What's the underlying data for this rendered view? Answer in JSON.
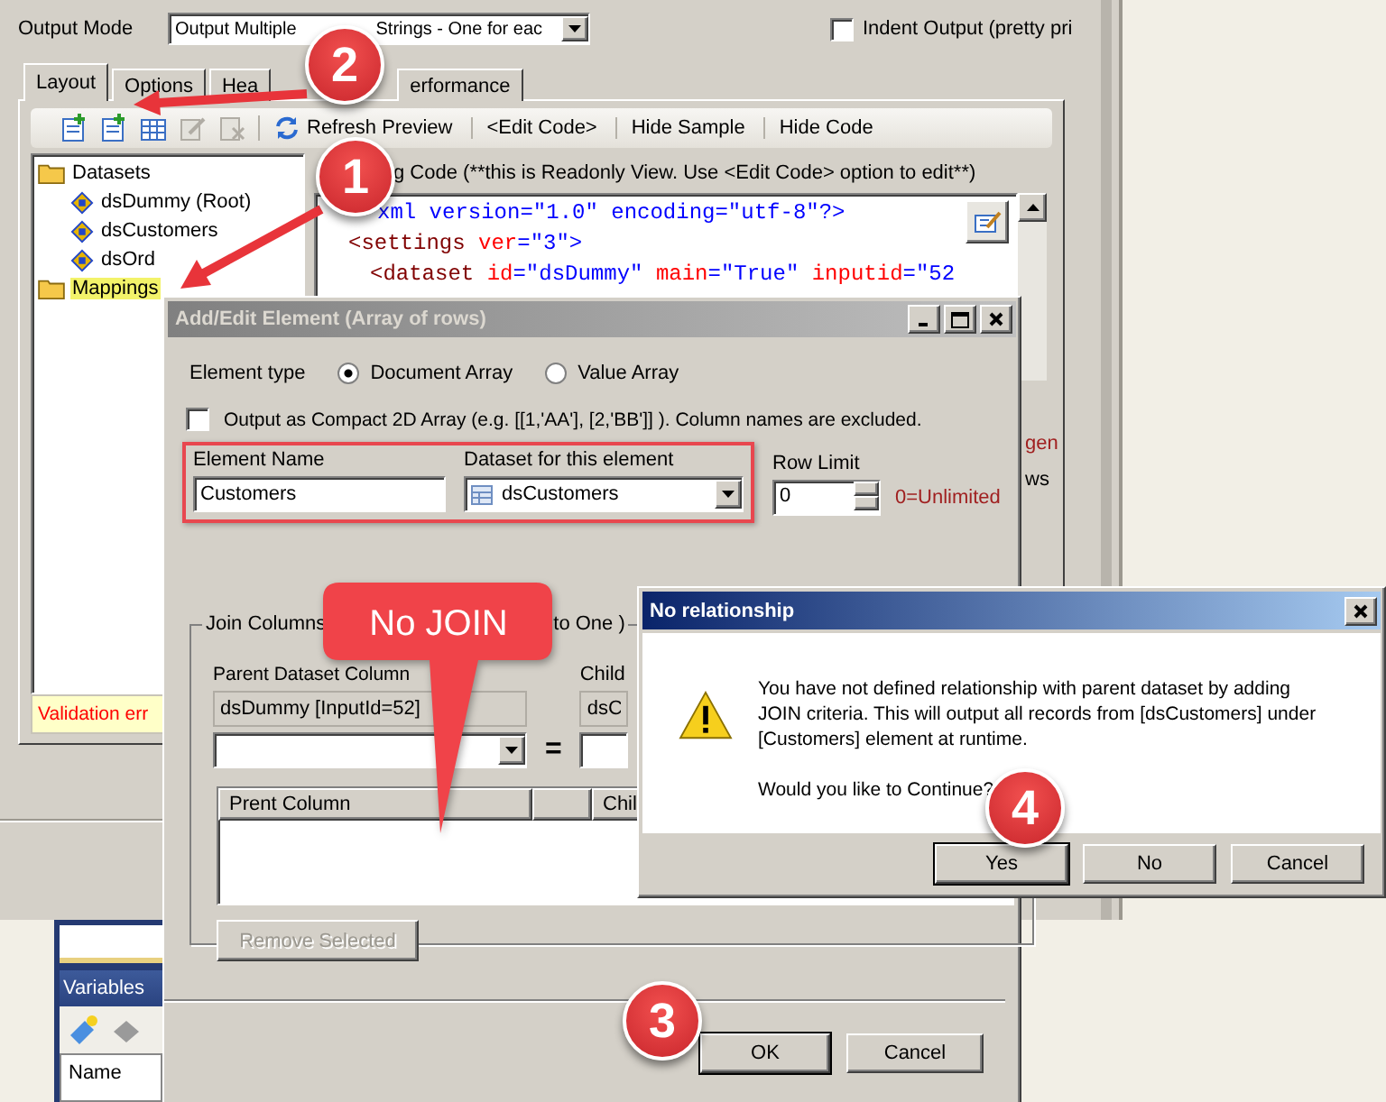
{
  "main_window": {
    "output_mode": {
      "label": "Output Mode",
      "value_parts": [
        "Output Multiple",
        "Strings - One for eac"
      ]
    },
    "indent_output": {
      "label": "Indent Output (pretty pri",
      "checked": false
    },
    "tabs": [
      {
        "label": "Layout",
        "selected": true
      },
      {
        "label": "Options",
        "selected": false
      },
      {
        "label": "Hea",
        "selected": false
      },
      {
        "label": "erformance",
        "selected": false
      }
    ],
    "toolbar": {
      "icons": [
        {
          "kind": "add",
          "disabled": false
        },
        {
          "kind": "add",
          "disabled": false
        },
        {
          "kind": "grid",
          "disabled": false
        },
        {
          "kind": "edit",
          "disabled": true
        },
        {
          "kind": "delete",
          "disabled": true
        }
      ],
      "buttons": [
        {
          "label": "Refresh Preview",
          "kind": "refresh"
        },
        {
          "label": "<Edit Code>",
          "kind": "text"
        },
        {
          "label": "Hide Sample",
          "kind": "text"
        },
        {
          "label": "Hide Code",
          "kind": "text"
        }
      ]
    },
    "tree": [
      {
        "label": "Datasets",
        "kind": "folder",
        "highlighted": false,
        "children": [
          {
            "label": "dsDummy (Root)",
            "kind": "dataset",
            "highlighted": false
          },
          {
            "label": "dsCustomers",
            "kind": "dataset",
            "highlighted": false
          },
          {
            "label": "dsOrd",
            "kind": "dataset",
            "highlighted": false
          }
        ]
      },
      {
        "label": "Mappings",
        "kind": "folder",
        "highlighted": true
      }
    ],
    "code_caption": "g Code (**this is Readonly View. Use <Edit Code> option to edit**)",
    "code_lines": [
      [
        {
          "text": "xml version=\"1.0\" encoding=\"utf-8\"?>",
          "kind": "value"
        }
      ],
      [
        {
          "text": "<settings ",
          "kind": "tag"
        },
        {
          "text": "ver",
          "kind": "attr"
        },
        {
          "text": "=\"3\">",
          "kind": "value"
        }
      ],
      [
        {
          "text": "<dataset ",
          "kind": "tag"
        },
        {
          "text": "id",
          "kind": "attr"
        },
        {
          "text": "=\"dsDummy\" ",
          "kind": "value"
        },
        {
          "text": "main",
          "kind": "attr"
        },
        {
          "text": "=\"True\" ",
          "kind": "value"
        },
        {
          "text": "inputid",
          "kind": "attr"
        },
        {
          "text": "=\"52",
          "kind": "value"
        }
      ]
    ],
    "side_notes": [
      "gen",
      "ws"
    ],
    "validation_message": "Validation err"
  },
  "edit_dialog": {
    "title": "Add/Edit Element (Array of rows)",
    "element_type": {
      "label": "Element type",
      "options": [
        {
          "label": "Document Array",
          "selected": true
        },
        {
          "label": "Value Array",
          "selected": false
        }
      ]
    },
    "compact_array": {
      "label": "Output as Compact 2D Array (e.g. [[1,'AA'], [2,'BB']] ). Column names are excluded.",
      "checked": false
    },
    "element_name": {
      "label": "Element Name",
      "value": "Customers"
    },
    "dataset": {
      "label": "Dataset for this element",
      "value": "dsCustomers"
    },
    "row_limit": {
      "label": "Row Limit",
      "value": "0",
      "hint": "0=Unlimited"
    },
    "join_group": {
      "title_parts": [
        "Join Columns",
        "to One )"
      ],
      "parent_label": "Parent Dataset Column",
      "parent_value": "dsDummy [InputId=52]",
      "operator": "=",
      "child_label": "Child",
      "child_value": "dsC",
      "columns": [
        "Prent Column",
        "Chil"
      ]
    },
    "remove_button": {
      "label": "Remove Selected",
      "disabled": true
    },
    "buttons": [
      "OK",
      "Cancel"
    ]
  },
  "message_dialog": {
    "title": "No relationship",
    "message_lines": [
      "You have not defined relationship with parent dataset by adding",
      "JOIN criteria. This will output all records from [dsCustomers] under",
      "[Customers] element at runtime."
    ],
    "question": "Would you like to Continue?",
    "buttons": [
      {
        "label": "Yes",
        "default": true
      },
      {
        "label": "No",
        "default": false
      },
      {
        "label": "Cancel",
        "default": false
      }
    ]
  },
  "variables_panel": {
    "title": "Variables",
    "columns": [
      "Name"
    ]
  },
  "annotations": {
    "steps": [
      "1",
      "2",
      "3",
      "4"
    ],
    "callout": "No JOIN"
  }
}
